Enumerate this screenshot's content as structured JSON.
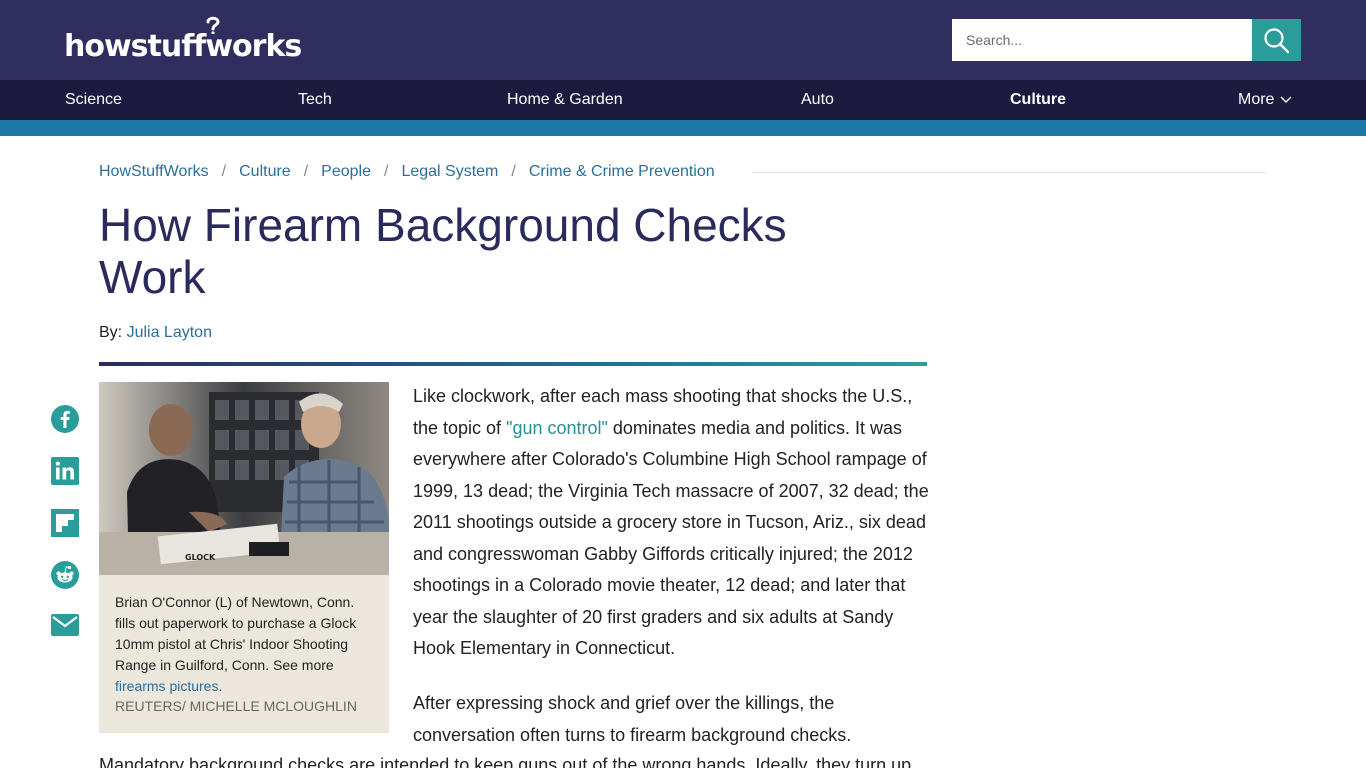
{
  "header": {
    "logo_text": "howstuffworks",
    "search_placeholder": "Search..."
  },
  "nav": {
    "items": [
      "Science",
      "Tech",
      "Home & Garden",
      "Auto",
      "Culture",
      "More"
    ],
    "active": "Culture"
  },
  "breadcrumb": [
    "HowStuffWorks",
    "Culture",
    "People",
    "Legal System",
    "Crime & Crime Prevention"
  ],
  "breadcrumb_separator": "/",
  "article": {
    "title": "How Firearm Background Checks Work",
    "byline_label": "By:",
    "author": "Julia Layton",
    "figure": {
      "caption_text": "Brian O'Connor (L) of Newtown, Conn. fills out paperwork to purchase a Glock 10mm pistol at Chris' Indoor Shooting Range in Guilford, Conn. See more",
      "caption_link": "firearms pictures",
      "caption_end": ".",
      "credit": "REUTERS/ MICHELLE MCLOUGHLIN"
    },
    "para1_start": "Like clockwork, after each mass shooting that shocks the U.S., the topic of ",
    "para1_link": "\"gun control\"",
    "para1_end": " dominates media and politics. It was everywhere after Colorado's Columbine High School rampage of 1999, 13 dead; the Virginia Tech massacre of 2007, 32 dead; the 2011 shootings outside a grocery store in Tucson, Ariz., six dead and congresswoman Gabby Giffords critically injured; the 2012 shootings in a Colorado movie theater, 12 dead; and later that year the slaughter of 20 first graders and six adults at Sandy Hook Elementary in Connecticut.",
    "para2": "After expressing shock and grief over the killings, the conversation often turns to firearm background checks.",
    "para3": "Mandatory background checks are intended to keep guns out of the wrong hands. Ideally, they turn up"
  },
  "share": [
    "facebook-icon",
    "linkedin-icon",
    "flipboard-icon",
    "reddit-icon",
    "email-icon"
  ],
  "colors": {
    "header_bg": "#302e5e",
    "nav_bg": "#1c1a3f",
    "stripe": "#1f79a8",
    "accent_teal": "#2a9d9b",
    "link": "#2a6f9b",
    "title": "#2b2a5c",
    "caption_bg": "#ece7dc"
  }
}
